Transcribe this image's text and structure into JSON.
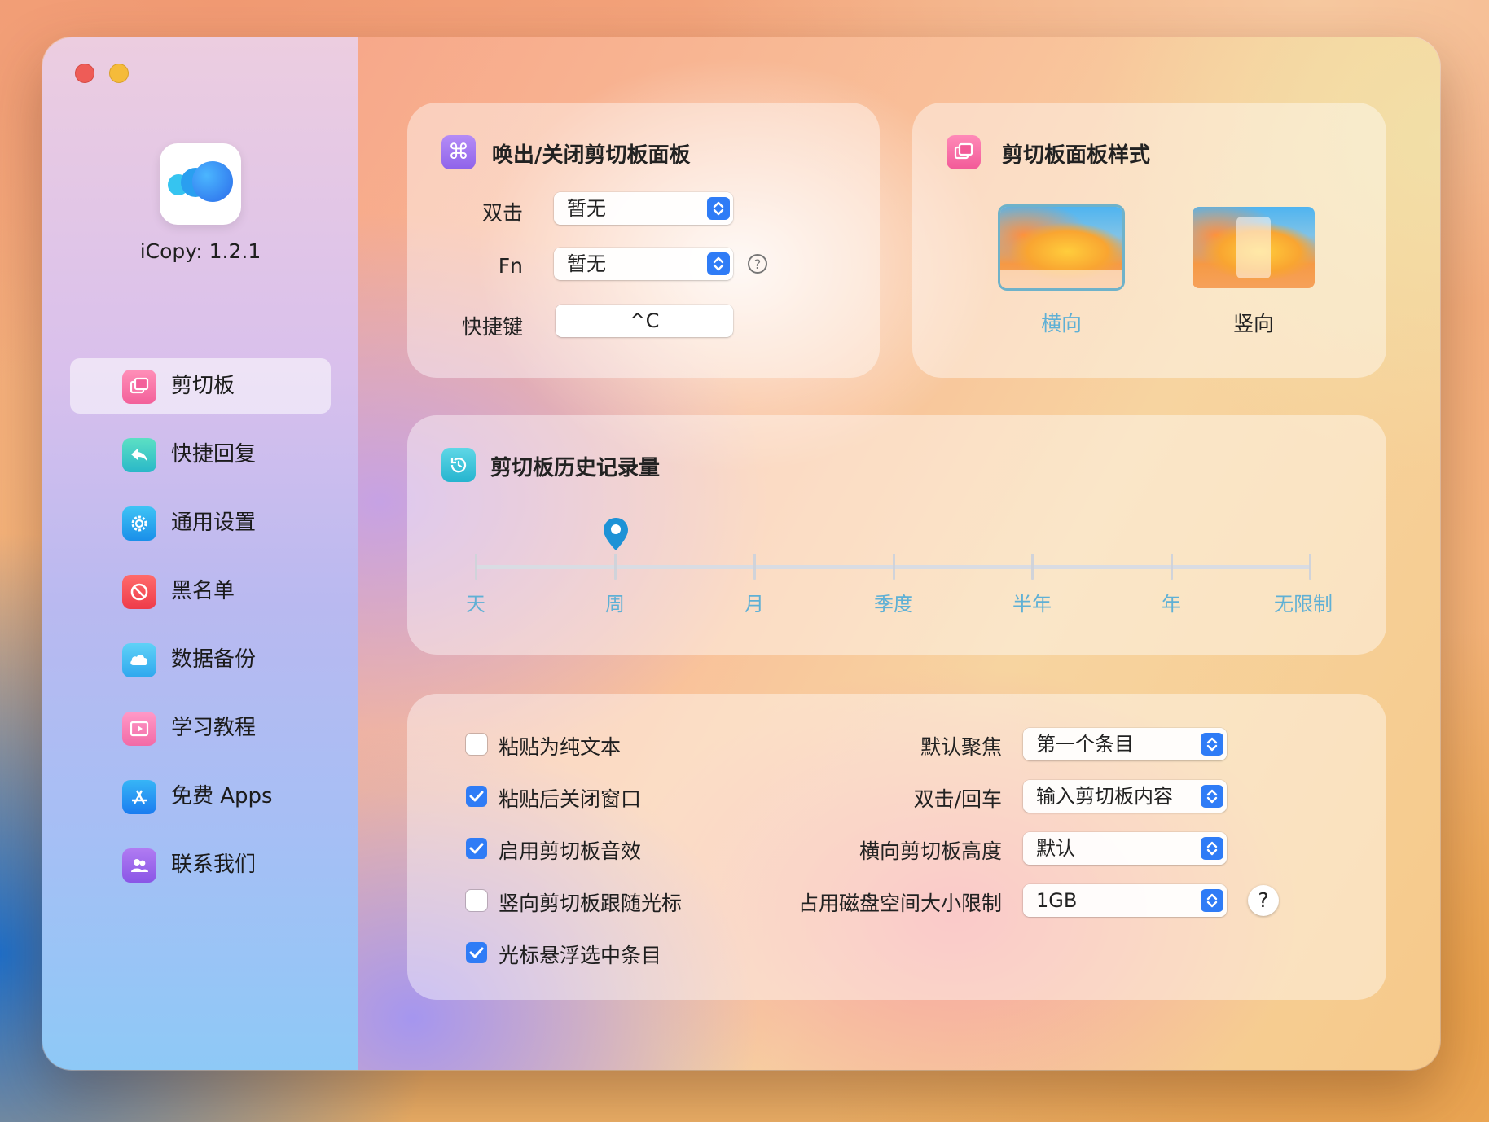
{
  "window": {
    "traffic_lights": [
      "close",
      "minimize"
    ]
  },
  "app": {
    "version_label": "iCopy: 1.2.1"
  },
  "sidebar": {
    "items": [
      {
        "label": "剪切板",
        "icon": "clipboard-icon",
        "active": true
      },
      {
        "label": "快捷回复",
        "icon": "reply-icon",
        "active": false
      },
      {
        "label": "通用设置",
        "icon": "gear-icon",
        "active": false
      },
      {
        "label": "黑名单",
        "icon": "block-icon",
        "active": false
      },
      {
        "label": "数据备份",
        "icon": "cloud-icon",
        "active": false
      },
      {
        "label": "学习教程",
        "icon": "video-icon",
        "active": false
      },
      {
        "label": "免费 Apps",
        "icon": "app-store-icon",
        "active": false
      },
      {
        "label": "联系我们",
        "icon": "contacts-icon",
        "active": false
      }
    ]
  },
  "toggle_panel": {
    "title": "唤出/关闭剪切板面板",
    "double_click_label": "双击",
    "double_click_value": "暂无",
    "fn_label": "Fn",
    "fn_value": "暂无",
    "shortcut_label": "快捷键",
    "shortcut_value": "^C"
  },
  "panel_style": {
    "title": "剪切板面板样式",
    "options": [
      {
        "label": "横向",
        "selected": true
      },
      {
        "label": "竖向",
        "selected": false
      }
    ]
  },
  "history": {
    "title": "剪切板历史记录量",
    "stops": [
      "天",
      "周",
      "月",
      "季度",
      "半年",
      "年",
      "无限制"
    ],
    "selected": "周",
    "selected_index": 1
  },
  "options": {
    "checkboxes": [
      {
        "label": "粘贴为纯文本",
        "checked": false
      },
      {
        "label": "粘贴后关闭窗口",
        "checked": true
      },
      {
        "label": "启用剪切板音效",
        "checked": true
      },
      {
        "label": "竖向剪切板跟随光标",
        "checked": false
      },
      {
        "label": "光标悬浮选中条目",
        "checked": true
      }
    ],
    "selects": [
      {
        "label": "默认聚焦",
        "value": "第一个条目"
      },
      {
        "label": "双击/回车",
        "value": "输入剪切板内容"
      },
      {
        "label": "横向剪切板高度",
        "value": "默认"
      },
      {
        "label": "占用磁盘空间大小限制",
        "value": "1GB"
      }
    ],
    "help_glyph": "?"
  },
  "colors": {
    "accent": "#2f7cf6",
    "slider_pin": "#1d92d6",
    "selected_style_label": "#5fb0d5"
  }
}
